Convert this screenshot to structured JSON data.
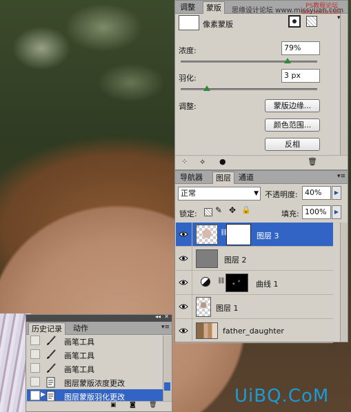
{
  "mask_panel": {
    "tabs": [
      "调整",
      "蒙版"
    ],
    "watermark_top": "思缘设计论坛 www.missyuan.com",
    "ps_logo": "PS教程论坛",
    "ps_logo_sub": "BBS.16XX8.COM",
    "mask_type": "像素蒙版",
    "density_label": "浓度:",
    "density_value": "79%",
    "feather_label": "羽化:",
    "feather_value": "3 px",
    "refine_label": "调整:",
    "btn_mask_edge": "蒙版边缘...",
    "btn_color_range": "颜色范围...",
    "btn_invert": "反相",
    "density_level": 0.79,
    "feather_level": 0.06
  },
  "layers_panel": {
    "tabs": [
      "导航器",
      "图层",
      "通道"
    ],
    "blend_mode": "正常",
    "opacity_label": "不透明度:",
    "opacity_value": "40%",
    "lock_label": "锁定:",
    "fill_label": "填充:",
    "fill_value": "100%",
    "layers": [
      {
        "name": "图层 3",
        "selected": true
      },
      {
        "name": "图层 2",
        "selected": false
      },
      {
        "name": "曲线 1",
        "selected": false
      },
      {
        "name": "图层 1",
        "selected": false
      },
      {
        "name": "father_daughter",
        "selected": false
      }
    ]
  },
  "history_panel": {
    "tabs": [
      "历史记录",
      "动作"
    ],
    "items": [
      {
        "label": "画笔工具",
        "icon": "brush-icon"
      },
      {
        "label": "画笔工具",
        "icon": "brush-icon"
      },
      {
        "label": "画笔工具",
        "icon": "brush-icon"
      },
      {
        "label": "图层蒙版浓度更改",
        "icon": "document-icon"
      },
      {
        "label": "图层蒙版羽化更改",
        "icon": "document-icon",
        "selected": true
      }
    ]
  },
  "watermark": "UiBQ.CoM",
  "colors": {
    "selection": "#3164c5",
    "panel_bg": "#d4d0c8",
    "slider_knob": "#2e8a3a",
    "watermark": "#1a9bd8"
  }
}
